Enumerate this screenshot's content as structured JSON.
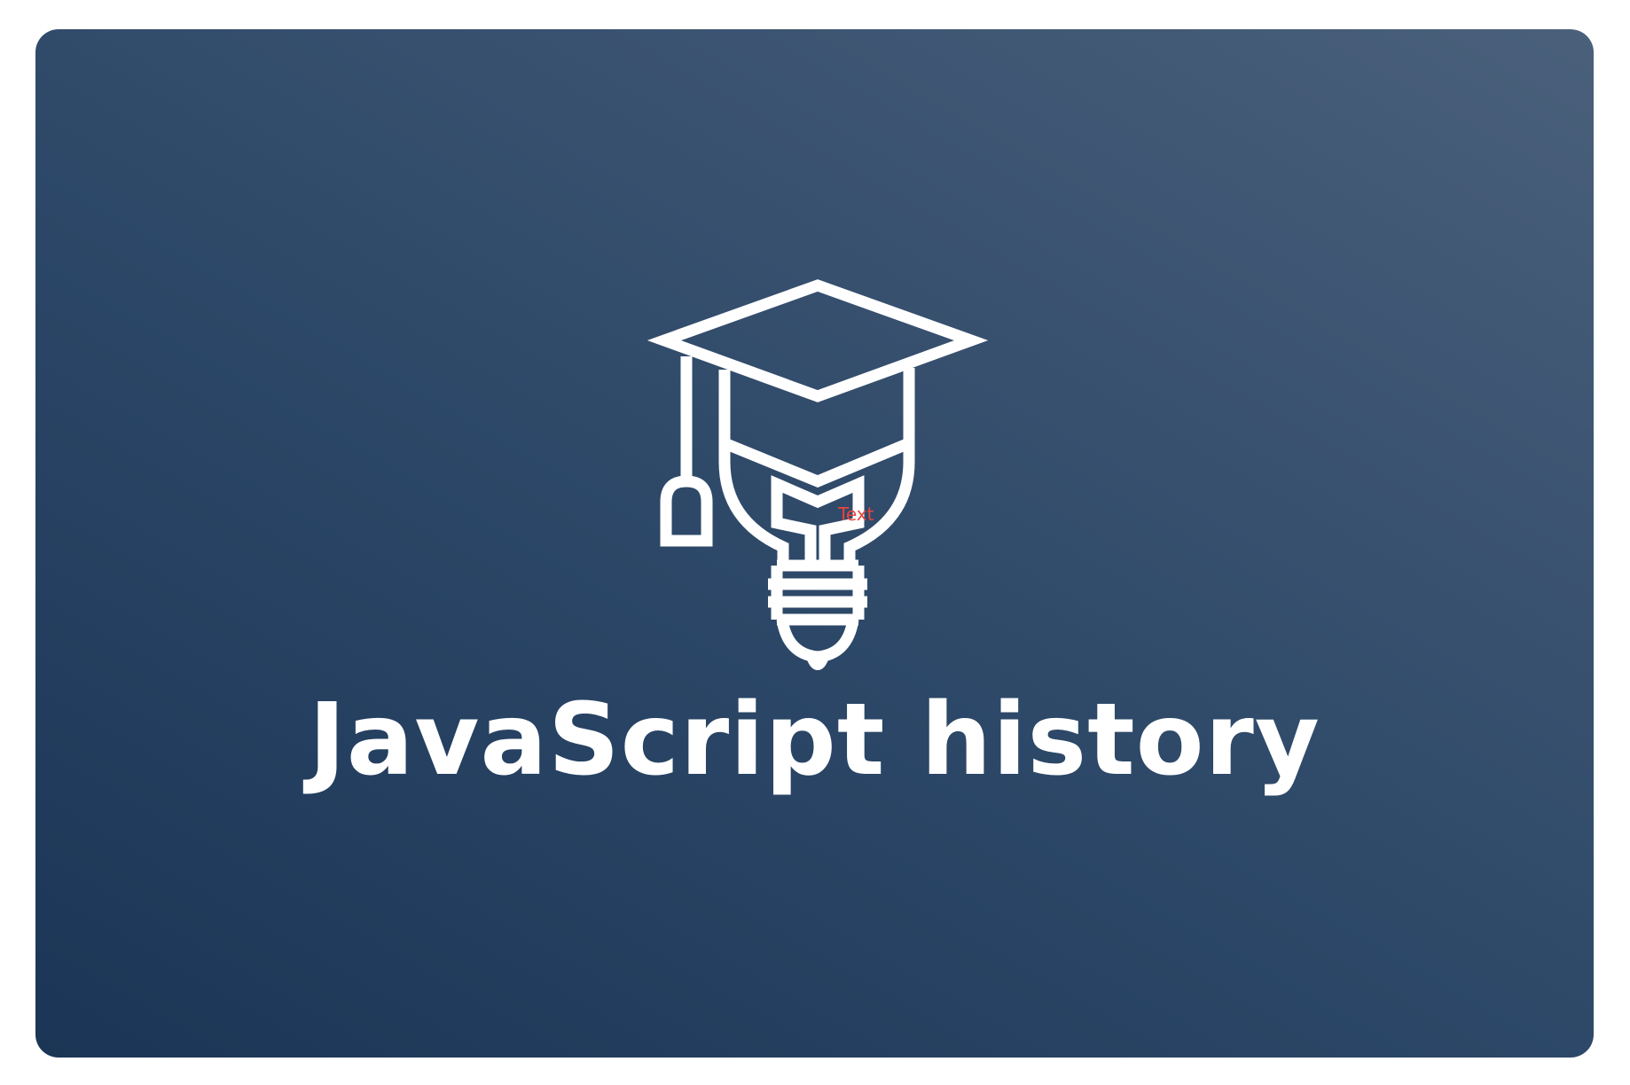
{
  "card": {
    "title": "JavaScript history",
    "stray_label": "Text"
  },
  "icon": {
    "name": "graduation-cap-lightbulb-icon"
  },
  "colors": {
    "gradient_start": "#1b3556",
    "gradient_end": "#4a607b",
    "foreground": "#ffffff",
    "stray_label": "#e8453c"
  }
}
